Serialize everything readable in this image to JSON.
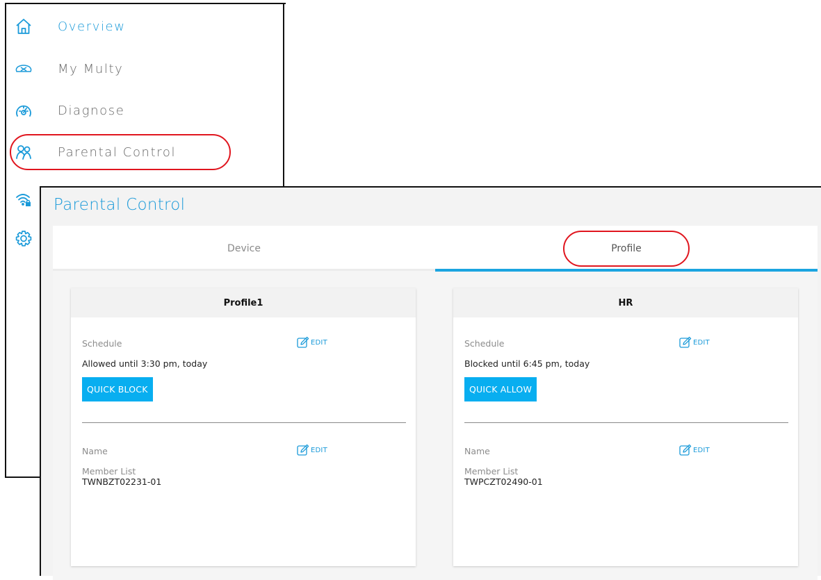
{
  "menu": {
    "items": [
      {
        "label": "Overview",
        "icon": "home-icon"
      },
      {
        "label": "My Multy",
        "icon": "multy-device-icon"
      },
      {
        "label": "Diagnose",
        "icon": "speedometer-icon"
      },
      {
        "label": "Parental Control",
        "icon": "parental-control-icon"
      },
      {
        "label": "",
        "icon": "wifi-lock-icon"
      },
      {
        "label": "",
        "icon": "gear-icon"
      }
    ]
  },
  "page": {
    "title": "Parental Control",
    "tabs": [
      {
        "label": "Device",
        "active": false
      },
      {
        "label": "Profile",
        "active": true
      }
    ]
  },
  "profiles": [
    {
      "name": "Profile1",
      "schedule_label": "Schedule",
      "schedule_status": "Allowed until 3:30 pm, today",
      "action_button": "QUICK BLOCK",
      "edit_label": "EDIT",
      "name_label": "Name",
      "member_list_label": "Member List",
      "members": [
        "TWNBZT02231-01"
      ]
    },
    {
      "name": "HR",
      "schedule_label": "Schedule",
      "schedule_status": "Blocked until 6:45 pm, today",
      "action_button": "QUICK ALLOW",
      "edit_label": "EDIT",
      "name_label": "Name",
      "member_list_label": "Member List",
      "members": [
        "TWPCZT02490-01"
      ]
    }
  ],
  "colors": {
    "accent": "#1a9ad9",
    "button": "#08aef0",
    "highlight": "#e0151e",
    "tab_underline": "#1ba5e0"
  }
}
